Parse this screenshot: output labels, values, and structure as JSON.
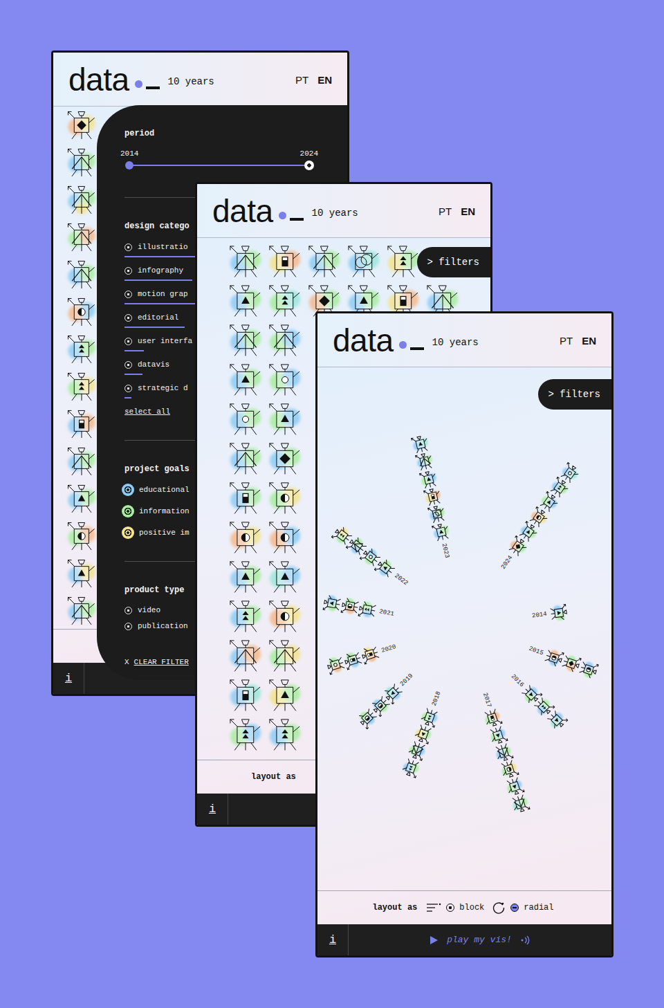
{
  "windows": [
    {
      "header": {
        "logo": "data",
        "tagline": "10 years",
        "languages": [
          {
            "label": "PT",
            "selected": false
          },
          {
            "label": "EN",
            "selected": true
          }
        ]
      },
      "glyphs": [
        {
          "kind": "diamond",
          "colors": [
            "#f5b98c",
            "#f3e38c"
          ]
        },
        {
          "kind": "mountain",
          "colors": [
            "#8ccbf4",
            "#a8eca0"
          ]
        },
        {
          "kind": "mountain",
          "colors": [
            "#8ccbf4",
            "#a8eca0",
            "#f3e38c"
          ]
        },
        {
          "kind": "mountain",
          "colors": [
            "#a8eca0",
            "#f5b98c"
          ]
        },
        {
          "kind": "mountain",
          "colors": [
            "#8ccbf4",
            "#a8eca0"
          ]
        },
        {
          "kind": "half",
          "colors": [
            "#f5b98c",
            "#8ccbf4"
          ]
        },
        {
          "kind": "stack",
          "colors": [
            "#8ccbf4",
            "#a8eca0"
          ]
        },
        {
          "kind": "stack",
          "colors": [
            "#a8eca0",
            "#f3e38c"
          ]
        },
        {
          "kind": "bar",
          "colors": [
            "#8ccbf4",
            "#f5b98c"
          ]
        },
        {
          "kind": "mountain",
          "colors": [
            "#8ccbf4",
            "#a8eca0"
          ]
        },
        {
          "kind": "triangle",
          "colors": [
            "#8ccbf4",
            "#a8eca0"
          ]
        },
        {
          "kind": "half",
          "colors": [
            "#a8eca0",
            "#f5b98c"
          ]
        },
        {
          "kind": "triangle",
          "colors": [
            "#8ccbf4",
            "#f3e38c"
          ]
        },
        {
          "kind": "mountain",
          "colors": [
            "#8ccbf4",
            "#a8eca0"
          ]
        }
      ],
      "filters": {
        "period": {
          "title": "period",
          "from": "2014",
          "to": "2024",
          "level": 1
        },
        "design_category": {
          "title": "design catego",
          "items": [
            {
              "label": "illustratio",
              "level": 1
            },
            {
              "label": "infography",
              "level": 0.96
            },
            {
              "label": "motion grap",
              "level": 1
            },
            {
              "label": "editorial",
              "level": 0.85
            },
            {
              "label": "user interfa",
              "level": 0.27
            },
            {
              "label": "datavis",
              "level": 0.25
            },
            {
              "label": "strategic d",
              "level": 0.1
            }
          ],
          "select_all": "select all"
        },
        "project_goals": {
          "title": "project goals",
          "items": [
            {
              "label": "educational",
              "color": "#8ccbf4"
            },
            {
              "label": "information",
              "color": "#a8eca0"
            },
            {
              "label": "positive im",
              "color": "#f3e38c"
            }
          ]
        },
        "product_type": {
          "title": "product type",
          "items": [
            {
              "label": "video"
            },
            {
              "label": "publication"
            }
          ]
        },
        "clear": {
          "icon": "X",
          "label": "CLEAR FILTER"
        }
      },
      "info": "i"
    },
    {
      "header": {
        "logo": "data",
        "tagline": "10 years",
        "languages": [
          {
            "label": "PT",
            "selected": false
          },
          {
            "label": "EN",
            "selected": true
          }
        ]
      },
      "filters_button": "> filters",
      "grid": [
        [
          {
            "kind": "mountain",
            "colors": [
              "#8ccbf4",
              "#a8eca0"
            ]
          },
          {
            "kind": "bar",
            "colors": [
              "#f3e38c",
              "#f5b98c"
            ]
          },
          {
            "kind": "mountain",
            "colors": [
              "#8ccbf4",
              "#a8eca0"
            ]
          },
          {
            "kind": "ring",
            "colors": [
              "#8ccbf4",
              "#9be6da"
            ]
          },
          {
            "kind": "stack",
            "colors": [
              "#f3e38c",
              "#a8eca0"
            ]
          }
        ],
        [
          {
            "kind": "triangle",
            "colors": [
              "#8ccbf4",
              "#a8eca0"
            ]
          },
          {
            "kind": "stack",
            "colors": [
              "#a8eca0",
              "#9be6da"
            ]
          },
          {
            "kind": "diamond",
            "colors": [
              "#f5b98c",
              "#a8eca0"
            ]
          },
          {
            "kind": "triangle",
            "colors": [
              "#8ccbf4",
              "#a8eca0"
            ]
          },
          {
            "kind": "bar",
            "colors": [
              "#f3e38c",
              "#f5b98c"
            ]
          },
          {
            "kind": "mountain",
            "colors": [
              "#8ccbf4",
              "#a8eca0"
            ]
          }
        ],
        [
          {
            "kind": "mountain",
            "colors": [
              "#8ccbf4",
              "#a8eca0"
            ]
          },
          {
            "kind": "mountain",
            "colors": [
              "#a8eca0",
              "#8ccbf4"
            ]
          }
        ],
        [
          {
            "kind": "triangle",
            "colors": [
              "#8ccbf4",
              "#a8eca0"
            ]
          },
          {
            "kind": "circle",
            "colors": [
              "#a8eca0",
              "#8ccbf4"
            ]
          }
        ],
        [
          {
            "kind": "circle",
            "colors": [
              "#8ccbf4",
              "#a8eca0"
            ]
          },
          {
            "kind": "triangle",
            "colors": [
              "#a8eca0",
              "#8ccbf4"
            ]
          }
        ],
        [
          {
            "kind": "mountain",
            "colors": [
              "#8ccbf4",
              "#a8eca0"
            ]
          },
          {
            "kind": "diamond",
            "colors": [
              "#8ccbf4",
              "#a8eca0"
            ]
          }
        ],
        [
          {
            "kind": "bar",
            "colors": [
              "#8ccbf4",
              "#a8eca0"
            ]
          },
          {
            "kind": "half",
            "colors": [
              "#a8eca0",
              "#f3e38c"
            ]
          }
        ],
        [
          {
            "kind": "half",
            "colors": [
              "#f5b98c",
              "#f3e38c"
            ]
          },
          {
            "kind": "half",
            "colors": [
              "#f5b98c",
              "#8ccbf4"
            ]
          }
        ],
        [
          {
            "kind": "triangle",
            "colors": [
              "#8ccbf4",
              "#a8eca0"
            ]
          },
          {
            "kind": "triangle",
            "colors": [
              "#9be6da",
              "#8ccbf4"
            ]
          }
        ],
        [
          {
            "kind": "stack",
            "colors": [
              "#8ccbf4",
              "#a8eca0"
            ]
          },
          {
            "kind": "half",
            "colors": [
              "#f5b98c",
              "#f3e38c"
            ]
          }
        ],
        [
          {
            "kind": "mountain",
            "colors": [
              "#8ccbf4",
              "#f5b98c"
            ]
          },
          {
            "kind": "mountain",
            "colors": [
              "#a8eca0",
              "#f3e38c"
            ]
          }
        ],
        [
          {
            "kind": "bar",
            "colors": [
              "#8ccbf4",
              "#9be6da"
            ]
          },
          {
            "kind": "triangle",
            "colors": [
              "#f3e38c",
              "#a8eca0"
            ]
          }
        ],
        [
          {
            "kind": "stack",
            "colors": [
              "#a8eca0",
              "#8ccbf4"
            ]
          },
          {
            "kind": "stack",
            "colors": [
              "#8ccbf4",
              "#a8eca0"
            ]
          }
        ]
      ],
      "layout": {
        "label": "layout as"
      },
      "info": "i"
    },
    {
      "header": {
        "logo": "data",
        "tagline": "10 years",
        "languages": [
          {
            "label": "PT",
            "selected": false
          },
          {
            "label": "EN",
            "selected": true
          }
        ]
      },
      "filters_button": "> filters",
      "radial": [
        {
          "year": "2014",
          "glyphs": [
            {
              "kind": "triangle",
              "colors": [
                "#8ccbf4",
                "#a8eca0"
              ]
            }
          ]
        },
        {
          "year": "2015",
          "glyphs": [
            {
              "kind": "half",
              "colors": [
                "#f5b98c",
                "#8ccbf4"
              ]
            },
            {
              "kind": "diamond",
              "colors": [
                "#a8eca0",
                "#f5b98c"
              ]
            },
            {
              "kind": "half",
              "colors": [
                "#8ccbf4",
                "#a8eca0"
              ]
            }
          ]
        },
        {
          "year": "2016",
          "glyphs": [
            {
              "kind": "triangle",
              "colors": [
                "#8ccbf4",
                "#a8eca0"
              ]
            },
            {
              "kind": "stack",
              "colors": [
                "#a8eca0",
                "#8ccbf4"
              ]
            },
            {
              "kind": "triangle",
              "colors": [
                "#8ccbf4",
                "#9be6da"
              ]
            }
          ]
        },
        {
          "year": "2017",
          "glyphs": [
            {
              "kind": "bar",
              "colors": [
                "#f5b98c",
                "#a8eca0"
              ]
            },
            {
              "kind": "triangle",
              "colors": [
                "#8ccbf4",
                "#a8eca0"
              ]
            },
            {
              "kind": "mountain",
              "colors": [
                "#a8eca0",
                "#8ccbf4"
              ]
            },
            {
              "kind": "half",
              "colors": [
                "#f3e38c",
                "#a8eca0"
              ]
            },
            {
              "kind": "triangle",
              "colors": [
                "#8ccbf4",
                "#a8eca0"
              ]
            },
            {
              "kind": "mountain",
              "colors": [
                "#a8eca0",
                "#9be6da"
              ]
            }
          ]
        },
        {
          "year": "2018",
          "glyphs": [
            {
              "kind": "stack",
              "colors": [
                "#8ccbf4",
                "#a8eca0"
              ]
            },
            {
              "kind": "triangle",
              "colors": [
                "#a8eca0",
                "#f3e38c"
              ]
            },
            {
              "kind": "mountain",
              "colors": [
                "#8ccbf4",
                "#a8eca0"
              ]
            },
            {
              "kind": "stack",
              "colors": [
                "#a8eca0",
                "#8ccbf4"
              ]
            }
          ]
        },
        {
          "year": "2019",
          "glyphs": [
            {
              "kind": "triangle",
              "colors": [
                "#8ccbf4",
                "#9be6da"
              ]
            },
            {
              "kind": "half",
              "colors": [
                "#a8eca0",
                "#8ccbf4"
              ]
            },
            {
              "kind": "half",
              "colors": [
                "#8ccbf4",
                "#a8eca0"
              ]
            }
          ]
        },
        {
          "year": "2020",
          "glyphs": [
            {
              "kind": "bar",
              "colors": [
                "#f5b98c",
                "#f3e38c"
              ]
            },
            {
              "kind": "bar",
              "colors": [
                "#8ccbf4",
                "#a8eca0"
              ]
            },
            {
              "kind": "circle",
              "colors": [
                "#f5b98c",
                "#a8eca0"
              ]
            }
          ]
        },
        {
          "year": "2021",
          "glyphs": [
            {
              "kind": "stack",
              "colors": [
                "#8ccbf4",
                "#a8eca0"
              ]
            },
            {
              "kind": "half",
              "colors": [
                "#f5b98c",
                "#a8eca0"
              ]
            },
            {
              "kind": "triangle",
              "colors": [
                "#a8eca0",
                "#8ccbf4"
              ]
            }
          ]
        },
        {
          "year": "2022",
          "glyphs": [
            {
              "kind": "triangle",
              "colors": [
                "#8ccbf4",
                "#a8eca0"
              ]
            },
            {
              "kind": "circle",
              "colors": [
                "#a8eca0",
                "#8ccbf4"
              ]
            },
            {
              "kind": "mountain",
              "colors": [
                "#8ccbf4",
                "#a8eca0"
              ]
            },
            {
              "kind": "stack",
              "colors": [
                "#a8eca0",
                "#f3e38c"
              ]
            }
          ]
        },
        {
          "year": "2023",
          "glyphs": [
            {
              "kind": "triangle",
              "colors": [
                "#8ccbf4",
                "#a8eca0"
              ]
            },
            {
              "kind": "ring",
              "colors": [
                "#8ccbf4",
                "#a8eca0"
              ]
            },
            {
              "kind": "bar",
              "colors": [
                "#f3e38c",
                "#f5b98c"
              ]
            },
            {
              "kind": "triangle",
              "colors": [
                "#a8eca0",
                "#8ccbf4"
              ]
            },
            {
              "kind": "mountain",
              "colors": [
                "#8ccbf4",
                "#a8eca0"
              ]
            },
            {
              "kind": "triangle",
              "colors": [
                "#8ccbf4",
                "#9be6da"
              ]
            }
          ]
        },
        {
          "year": "2024",
          "glyphs": [
            {
              "kind": "diamond",
              "colors": [
                "#f5b98c",
                "#a8eca0"
              ]
            },
            {
              "kind": "triangle",
              "colors": [
                "#8ccbf4",
                "#a8eca0"
              ]
            },
            {
              "kind": "half",
              "colors": [
                "#f5b98c",
                "#f3e38c"
              ]
            },
            {
              "kind": "triangle",
              "colors": [
                "#a8eca0",
                "#8ccbf4"
              ]
            },
            {
              "kind": "stack",
              "colors": [
                "#8ccbf4",
                "#a8eca0"
              ]
            },
            {
              "kind": "circle",
              "colors": [
                "#8ccbf4",
                "#9be6da"
              ]
            }
          ]
        }
      ],
      "layout": {
        "label": "layout as",
        "options": [
          {
            "label": "block",
            "kind": "block",
            "selected": false
          },
          {
            "label": "radial",
            "kind": "radial",
            "selected": true
          }
        ]
      },
      "info": "i",
      "play": "play my vis!"
    }
  ]
}
